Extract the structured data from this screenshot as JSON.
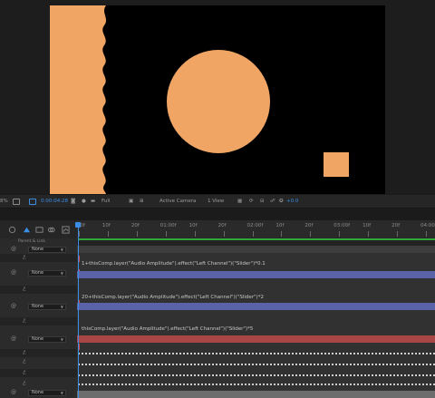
{
  "viewer": {
    "zoom": "8%",
    "timecode": "0:00:04:28",
    "resolution": "Full",
    "camera": "Active Camera",
    "views": "1 View",
    "exposure": "+0.0",
    "colors": {
      "shape": "#f0a564",
      "background": "#000000"
    }
  },
  "timeline": {
    "columns": {
      "parent": "Parent & Link"
    },
    "ruler_labels": [
      "00f",
      "10f",
      "20f",
      "01:00f",
      "10f",
      "20f",
      "02:00f",
      "10f",
      "20f",
      "03:00f",
      "10f",
      "20f",
      "04:00"
    ],
    "layers": [
      {
        "parent": "None"
      },
      {
        "parent": "None",
        "expression": "1+thisComp.layer(\"Audio Amplitude\").effect(\"Left Channel\")(\"Slider\")*0.1"
      },
      {
        "parent": "None",
        "expression": "20+thisComp.layer(\"Audio Amplitude\").effect(\"Left Channel\")(\"Slider\")*2"
      },
      {
        "parent": "None",
        "expression": "thisComp.layer(\"Audio Amplitude\").effect(\"Left Channel\")(\"Slider\")*5"
      },
      {
        "parent": "None"
      }
    ],
    "colors": {
      "playhead": "#3a8ee6",
      "work_area": "#2fa83a",
      "purple_bar": "#5a62a8",
      "red_bar": "#a84646",
      "gray_bar": "#6d6d6d"
    }
  }
}
